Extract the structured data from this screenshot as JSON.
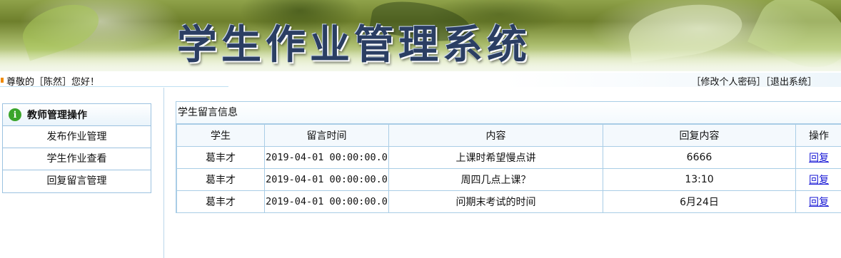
{
  "header": {
    "title": "学生作业管理系统"
  },
  "statusbar": {
    "greeting": "尊敬的［陈然］您好！",
    "change_password": "［修改个人密码］",
    "logout": "［退出系统］"
  },
  "sidebar": {
    "heading": "教师管理操作",
    "items": [
      {
        "label": "发布作业管理"
      },
      {
        "label": "学生作业查看"
      },
      {
        "label": "回复留言管理"
      }
    ]
  },
  "messages": {
    "title": "学生留言信息",
    "columns": [
      "学生",
      "留言时间",
      "内容",
      "回复内容",
      "操作"
    ],
    "rows": [
      {
        "student": "葛丰才",
        "time": "2019-04-01 00:00:00.0",
        "content": "上课时希望慢点讲",
        "reply": "6666",
        "action": "回复"
      },
      {
        "student": "葛丰才",
        "time": "2019-04-01 00:00:00.0",
        "content": "周四几点上课？",
        "reply": "13:10",
        "action": "回复"
      },
      {
        "student": "葛丰才",
        "time": "2019-04-01 00:00:00.0",
        "content": "问期末考试的时间",
        "reply": "6月24日",
        "action": "回复"
      }
    ]
  },
  "colors": {
    "border": "#a9cde6",
    "link": "#1a1ad6",
    "accent_bullet": "#f08a00",
    "title_text": "#2b3e63"
  },
  "icons": {
    "sidebar_heading": "info-icon"
  }
}
